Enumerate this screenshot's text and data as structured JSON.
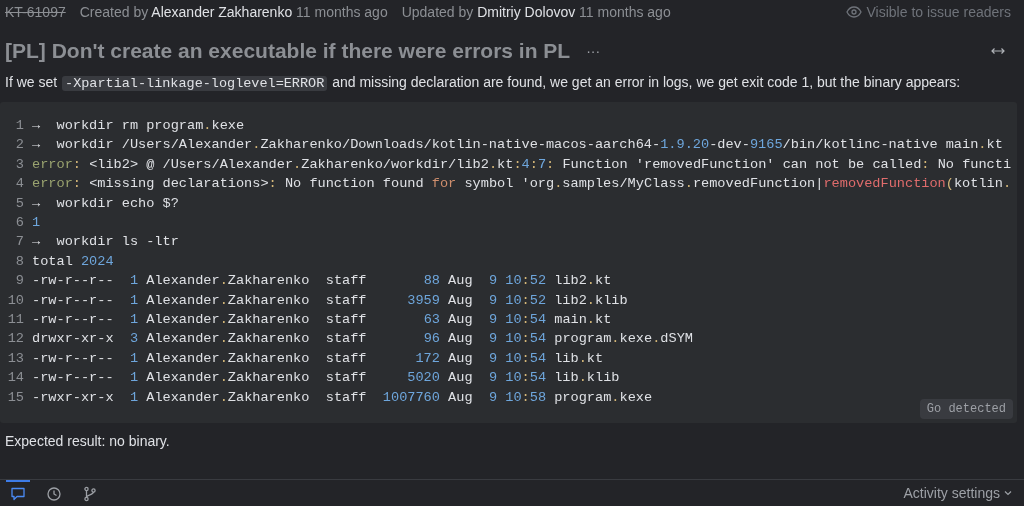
{
  "issue": {
    "id": "KT-61097",
    "resolved": true,
    "created_label": "Created by",
    "creator": "Alexander Zakharenko",
    "created_time": "11 months ago",
    "updated_label": "Updated by",
    "updater": "Dmitriy Dolovov",
    "updated_time": "11 months ago",
    "visibility": "Visible to issue readers"
  },
  "title": "[PL] Don't create an executable if there were errors in PL",
  "more_button": "···",
  "description": [
    {
      "kind": "text",
      "text": "If we set "
    },
    {
      "kind": "code",
      "text": "-Xpartial-linkage-loglevel=ERROR"
    },
    {
      "kind": "text",
      "text": " and missing declaration are found, we get an error in logs, we get exit code 1, but the binary appears:"
    }
  ],
  "code_block": {
    "badge": "Go detected",
    "lines": [
      {
        "number": "1",
        "segments": [
          {
            "kind": "plain",
            "text": "→  workdir rm program"
          },
          {
            "kind": "punct",
            "text": "."
          },
          {
            "kind": "plain",
            "text": "kexe"
          }
        ]
      },
      {
        "number": "2",
        "segments": [
          {
            "kind": "plain",
            "text": "→  workdir /Users/Alexander"
          },
          {
            "kind": "punct",
            "text": "."
          },
          {
            "kind": "plain",
            "text": "Zakharenko/Downloads/kotlin-native-macos-aarch64-"
          },
          {
            "kind": "number",
            "text": "1.9.20"
          },
          {
            "kind": "plain",
            "text": "-dev-"
          },
          {
            "kind": "number",
            "text": "9165"
          },
          {
            "kind": "plain",
            "text": "/bin/kotlinc-native main"
          },
          {
            "kind": "punct",
            "text": "."
          },
          {
            "kind": "plain",
            "text": "kt"
          }
        ]
      },
      {
        "number": "3",
        "segments": [
          {
            "kind": "error",
            "text": "error"
          },
          {
            "kind": "punct",
            "text": ":"
          },
          {
            "kind": "plain",
            "text": " <lib2> @ /Users/Alexander"
          },
          {
            "kind": "punct",
            "text": "."
          },
          {
            "kind": "plain",
            "text": "Zakharenko/workdir/lib2"
          },
          {
            "kind": "punct",
            "text": "."
          },
          {
            "kind": "plain",
            "text": "kt"
          },
          {
            "kind": "punct",
            "text": ":"
          },
          {
            "kind": "number",
            "text": "4"
          },
          {
            "kind": "punct",
            "text": ":"
          },
          {
            "kind": "number",
            "text": "7"
          },
          {
            "kind": "punct",
            "text": ":"
          },
          {
            "kind": "plain",
            "text": " Function 'removedFunction' can not be called"
          },
          {
            "kind": "punct",
            "text": ":"
          },
          {
            "kind": "plain",
            "text": " No functi"
          }
        ]
      },
      {
        "number": "4",
        "segments": [
          {
            "kind": "error",
            "text": "error"
          },
          {
            "kind": "punct",
            "text": ":"
          },
          {
            "kind": "plain",
            "text": " <missing declarations>"
          },
          {
            "kind": "punct",
            "text": ":"
          },
          {
            "kind": "plain",
            "text": " No function found "
          },
          {
            "kind": "keyword",
            "text": "for"
          },
          {
            "kind": "plain",
            "text": " symbol 'org"
          },
          {
            "kind": "punct",
            "text": "."
          },
          {
            "kind": "plain",
            "text": "samples/MyClass"
          },
          {
            "kind": "punct",
            "text": "."
          },
          {
            "kind": "plain",
            "text": "removedFunction|"
          },
          {
            "kind": "call",
            "text": "removedFunction"
          },
          {
            "kind": "punct",
            "text": "("
          },
          {
            "kind": "plain",
            "text": "kotlin"
          },
          {
            "kind": "punct",
            "text": "."
          }
        ]
      },
      {
        "number": "5",
        "segments": [
          {
            "kind": "plain",
            "text": "→  workdir echo $?"
          }
        ]
      },
      {
        "number": "6",
        "segments": [
          {
            "kind": "number",
            "text": "1"
          }
        ]
      },
      {
        "number": "7",
        "segments": [
          {
            "kind": "plain",
            "text": "→  workdir ls -ltr"
          }
        ]
      },
      {
        "number": "8",
        "segments": [
          {
            "kind": "plain",
            "text": "total "
          },
          {
            "kind": "number",
            "text": "2024"
          }
        ]
      },
      {
        "number": "9",
        "segments": [
          {
            "kind": "plain",
            "text": "-rw-r--r--  "
          },
          {
            "kind": "number",
            "text": "1"
          },
          {
            "kind": "plain",
            "text": " Alexander"
          },
          {
            "kind": "punct",
            "text": "."
          },
          {
            "kind": "plain",
            "text": "Zakharenko  staff       "
          },
          {
            "kind": "number",
            "text": "88"
          },
          {
            "kind": "plain",
            "text": " Aug  "
          },
          {
            "kind": "number",
            "text": "9 "
          },
          {
            "kind": "number",
            "text": "10"
          },
          {
            "kind": "punct",
            "text": ":"
          },
          {
            "kind": "number",
            "text": "52"
          },
          {
            "kind": "plain",
            "text": " lib2"
          },
          {
            "kind": "punct",
            "text": "."
          },
          {
            "kind": "plain",
            "text": "kt"
          }
        ]
      },
      {
        "number": "10",
        "segments": [
          {
            "kind": "plain",
            "text": "-rw-r--r--  "
          },
          {
            "kind": "number",
            "text": "1"
          },
          {
            "kind": "plain",
            "text": " Alexander"
          },
          {
            "kind": "punct",
            "text": "."
          },
          {
            "kind": "plain",
            "text": "Zakharenko  staff     "
          },
          {
            "kind": "number",
            "text": "3959"
          },
          {
            "kind": "plain",
            "text": " Aug  "
          },
          {
            "kind": "number",
            "text": "9 "
          },
          {
            "kind": "number",
            "text": "10"
          },
          {
            "kind": "punct",
            "text": ":"
          },
          {
            "kind": "number",
            "text": "52"
          },
          {
            "kind": "plain",
            "text": " lib2"
          },
          {
            "kind": "punct",
            "text": "."
          },
          {
            "kind": "plain",
            "text": "klib"
          }
        ]
      },
      {
        "number": "11",
        "segments": [
          {
            "kind": "plain",
            "text": "-rw-r--r--  "
          },
          {
            "kind": "number",
            "text": "1"
          },
          {
            "kind": "plain",
            "text": " Alexander"
          },
          {
            "kind": "punct",
            "text": "."
          },
          {
            "kind": "plain",
            "text": "Zakharenko  staff       "
          },
          {
            "kind": "number",
            "text": "63"
          },
          {
            "kind": "plain",
            "text": " Aug  "
          },
          {
            "kind": "number",
            "text": "9 "
          },
          {
            "kind": "number",
            "text": "10"
          },
          {
            "kind": "punct",
            "text": ":"
          },
          {
            "kind": "number",
            "text": "54"
          },
          {
            "kind": "plain",
            "text": " main"
          },
          {
            "kind": "punct",
            "text": "."
          },
          {
            "kind": "plain",
            "text": "kt"
          }
        ]
      },
      {
        "number": "12",
        "segments": [
          {
            "kind": "plain",
            "text": "drwxr-xr-x  "
          },
          {
            "kind": "number",
            "text": "3"
          },
          {
            "kind": "plain",
            "text": " Alexander"
          },
          {
            "kind": "punct",
            "text": "."
          },
          {
            "kind": "plain",
            "text": "Zakharenko  staff       "
          },
          {
            "kind": "number",
            "text": "96"
          },
          {
            "kind": "plain",
            "text": " Aug  "
          },
          {
            "kind": "number",
            "text": "9 "
          },
          {
            "kind": "number",
            "text": "10"
          },
          {
            "kind": "punct",
            "text": ":"
          },
          {
            "kind": "number",
            "text": "54"
          },
          {
            "kind": "plain",
            "text": " program"
          },
          {
            "kind": "punct",
            "text": "."
          },
          {
            "kind": "plain",
            "text": "kexe"
          },
          {
            "kind": "punct",
            "text": "."
          },
          {
            "kind": "plain",
            "text": "dSYM"
          }
        ]
      },
      {
        "number": "13",
        "segments": [
          {
            "kind": "plain",
            "text": "-rw-r--r--  "
          },
          {
            "kind": "number",
            "text": "1"
          },
          {
            "kind": "plain",
            "text": " Alexander"
          },
          {
            "kind": "punct",
            "text": "."
          },
          {
            "kind": "plain",
            "text": "Zakharenko  staff      "
          },
          {
            "kind": "number",
            "text": "172"
          },
          {
            "kind": "plain",
            "text": " Aug  "
          },
          {
            "kind": "number",
            "text": "9 "
          },
          {
            "kind": "number",
            "text": "10"
          },
          {
            "kind": "punct",
            "text": ":"
          },
          {
            "kind": "number",
            "text": "54"
          },
          {
            "kind": "plain",
            "text": " lib"
          },
          {
            "kind": "punct",
            "text": "."
          },
          {
            "kind": "plain",
            "text": "kt"
          }
        ]
      },
      {
        "number": "14",
        "segments": [
          {
            "kind": "plain",
            "text": "-rw-r--r--  "
          },
          {
            "kind": "number",
            "text": "1"
          },
          {
            "kind": "plain",
            "text": " Alexander"
          },
          {
            "kind": "punct",
            "text": "."
          },
          {
            "kind": "plain",
            "text": "Zakharenko  staff     "
          },
          {
            "kind": "number",
            "text": "5020"
          },
          {
            "kind": "plain",
            "text": " Aug  "
          },
          {
            "kind": "number",
            "text": "9 "
          },
          {
            "kind": "number",
            "text": "10"
          },
          {
            "kind": "punct",
            "text": ":"
          },
          {
            "kind": "number",
            "text": "54"
          },
          {
            "kind": "plain",
            "text": " lib"
          },
          {
            "kind": "punct",
            "text": "."
          },
          {
            "kind": "plain",
            "text": "klib"
          }
        ]
      },
      {
        "number": "15",
        "segments": [
          {
            "kind": "plain",
            "text": "-rwxr-xr-x  "
          },
          {
            "kind": "number",
            "text": "1"
          },
          {
            "kind": "plain",
            "text": " Alexander"
          },
          {
            "kind": "punct",
            "text": "."
          },
          {
            "kind": "plain",
            "text": "Zakharenko  staff  "
          },
          {
            "kind": "number",
            "text": "1007760"
          },
          {
            "kind": "plain",
            "text": " Aug  "
          },
          {
            "kind": "number",
            "text": "9 "
          },
          {
            "kind": "number",
            "text": "10"
          },
          {
            "kind": "punct",
            "text": ":"
          },
          {
            "kind": "number",
            "text": "58"
          },
          {
            "kind": "plain",
            "text": " program"
          },
          {
            "kind": "punct",
            "text": "."
          },
          {
            "kind": "plain",
            "text": "kexe"
          }
        ]
      }
    ]
  },
  "expected": "Expected result: no binary.",
  "activity_tabs": [
    {
      "kind": "comments",
      "selected": true
    },
    {
      "kind": "history",
      "selected": false
    },
    {
      "kind": "vcs",
      "selected": false
    }
  ],
  "activity_settings": "Activity settings"
}
